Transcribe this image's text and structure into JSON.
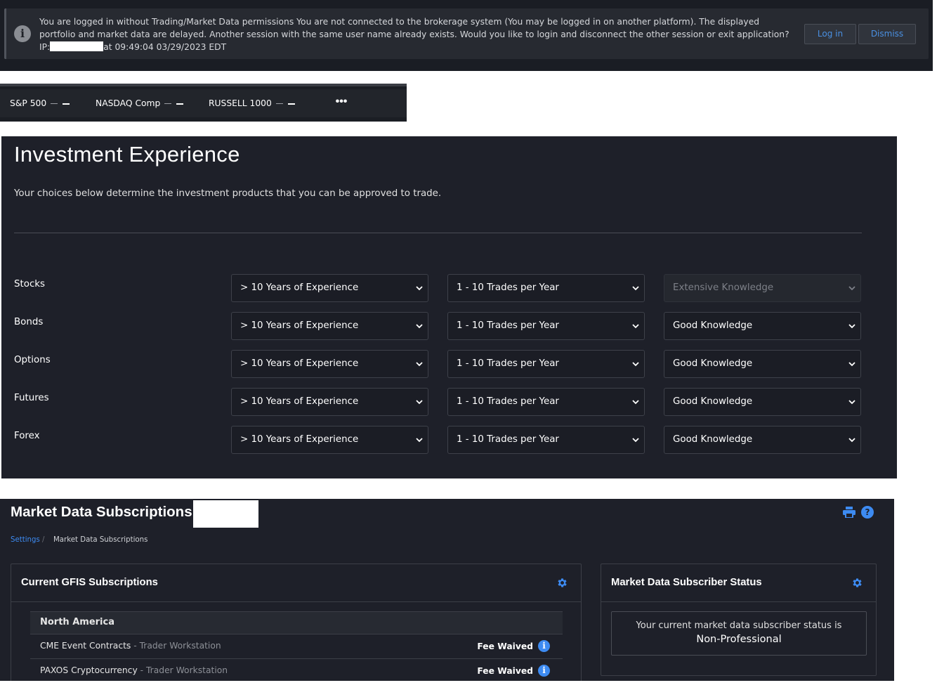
{
  "banner": {
    "message_before_ip": "You are logged in without Trading/Market Data permissions You are not connected to the brokerage system (You may be logged in on another platform). The displayed portfolio and market data are delayed. Another session with the same user name already exists. Would you like to login and disconnect the other session or exit application? IP:",
    "message_after_ip": "at 09:49:04 03/29/2023 EDT",
    "login_label": "Log in",
    "dismiss_label": "Dismiss",
    "icon": "info-icon"
  },
  "ticker": {
    "items": [
      {
        "label": "S&P 500"
      },
      {
        "label": "NASDAQ Comp"
      },
      {
        "label": "RUSSELL 1000"
      }
    ],
    "more_label": "•••"
  },
  "investment": {
    "title": "Investment Experience",
    "description": "Your choices below determine the investment products that you can be approved to trade.",
    "rows": [
      {
        "label": "Stocks",
        "years": "> 10 Years of Experience",
        "trades": "1 - 10 Trades per Year",
        "knowledge": "Extensive Knowledge",
        "knowledge_disabled": true
      },
      {
        "label": "Bonds",
        "years": "> 10 Years of Experience",
        "trades": "1 - 10 Trades per Year",
        "knowledge": "Good Knowledge",
        "knowledge_disabled": false
      },
      {
        "label": "Options",
        "years": "> 10 Years of Experience",
        "trades": "1 - 10 Trades per Year",
        "knowledge": "Good Knowledge",
        "knowledge_disabled": false
      },
      {
        "label": "Futures",
        "years": "> 10 Years of Experience",
        "trades": "1 - 10 Trades per Year",
        "knowledge": "Good Knowledge",
        "knowledge_disabled": false
      },
      {
        "label": "Forex",
        "years": "> 10 Years of Experience",
        "trades": "1 - 10 Trades per Year",
        "knowledge": "Good Knowledge",
        "knowledge_disabled": false
      }
    ]
  },
  "market_data": {
    "title": "Market Data Subscriptions",
    "breadcrumb": {
      "root": "Settings",
      "separator": "/",
      "current": "Market Data Subscriptions"
    },
    "subscriptions_panel": {
      "title": "Current GFIS Subscriptions",
      "region": "North America",
      "rows": [
        {
          "name": "CME Event Contracts",
          "platform": " - Trader Workstation",
          "fee": "Fee Waived"
        },
        {
          "name": "PAXOS Cryptocurrency",
          "platform": " - Trader Workstation",
          "fee": "Fee Waived"
        }
      ]
    },
    "status_panel": {
      "title": "Market Data Subscriber Status",
      "line1": "Your current market data subscriber status is",
      "line2": "Non-Professional"
    }
  },
  "colors": {
    "accent": "#3d8bf2",
    "panel_bg": "#1e2029",
    "banner_bg": "#272a31"
  }
}
